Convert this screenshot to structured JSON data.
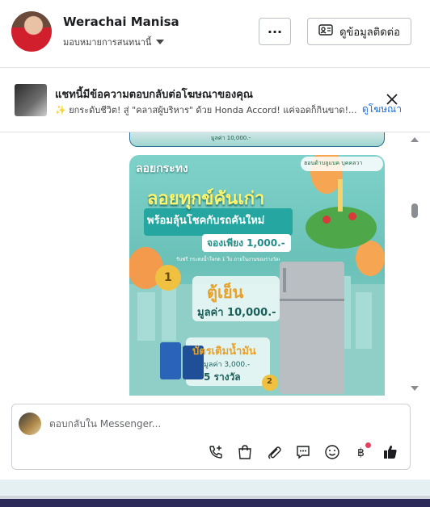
{
  "header": {
    "name": "Werachai Manisa",
    "subtitle": "มอบหมายการสนทนานี้",
    "more_label": "···",
    "contact_label": "ดูข้อมูลติดต่อ"
  },
  "notice": {
    "title": "แชทนี้มีข้อความตอบกลับต่อโฆษณาของคุณ",
    "description": "✨ ยกระดับชีวิต! สู่ \"คลาสผู้บริหาร\" ด้วย Honda Accord! แค่จอดก็กินขาด!...",
    "link": "ดูโฆษณา"
  },
  "chat": {
    "prev_image_caption": "มูลค่า 10,000.-",
    "promo": {
      "tag": "ลอยกระทง",
      "headline": "ลอยทุกข์คันเก่า",
      "subheadline": "พร้อมลุ้นโชคกับรถคันใหม่",
      "deposit": "จองเพียง 1,000.-",
      "fine_print": "รับฟรี กระทงน้ำใจกด 1 ใบ ภายในงานของรางวัลย่อยอยู่",
      "brand": "ฮอนด้าบลูแบค บุคคลวา",
      "prize1_rank": "1",
      "prize1_name": "ตู้เย็น",
      "prize1_value": "มูลค่า 10,000.-",
      "prize2_rank": "2",
      "prize2_name": "บัตรเติมน้ำมัน",
      "prize2_value": "มูลค่า 3,000.-",
      "prize2_count": "5 รางวัล"
    }
  },
  "composer": {
    "placeholder": "ตอบกลับใน Messenger..."
  },
  "tools": [
    "phone-plus-icon",
    "shopping-bag-icon",
    "paperclip-icon",
    "chat-bubble-icon",
    "smiley-icon",
    "baht-icon",
    "thumbs-up-icon"
  ],
  "colors": {
    "link": "#1a6ed8",
    "promo_teal": "#6ac1b8",
    "thumbs_up": "#1c1e21",
    "badge": "#e4405f"
  }
}
